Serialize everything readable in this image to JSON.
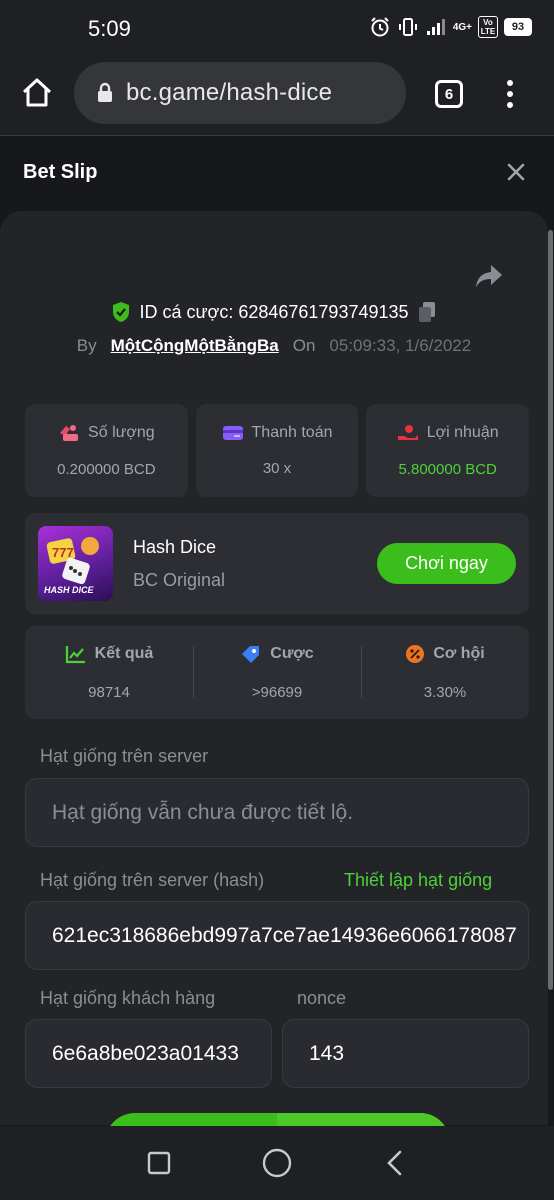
{
  "status_bar": {
    "time": "5:09",
    "network": "4G+",
    "volte": "Vo LTE",
    "battery": "93"
  },
  "browser": {
    "url": "bc.game/hash-dice",
    "tab_count": "6"
  },
  "header": {
    "title": "Bet Slip"
  },
  "bet": {
    "id_text": "ID cá cược: 62846761793749135",
    "by_label": "By",
    "username": "MộtCộngMộtBằngBa",
    "on_label": "On",
    "datetime": "05:09:33, 1/6/2022"
  },
  "stats": [
    {
      "label": "Số lượng",
      "value": "0.200000 BCD"
    },
    {
      "label": "Thanh toán",
      "value": "30 x"
    },
    {
      "label": "Lợi nhuận",
      "value": "5.800000 BCD"
    }
  ],
  "game": {
    "name": "Hash Dice",
    "subtitle": "BC Original",
    "thumb_label": "HASH DICE",
    "play_label": "Chơi ngay"
  },
  "results": [
    {
      "label": "Kết quả",
      "value": "98714"
    },
    {
      "label": "Cược",
      "value": ">96699"
    },
    {
      "label": "Cơ hội",
      "value": "3.30%"
    }
  ],
  "seeds": {
    "server_seed_label": "Hạt giống trên server",
    "server_seed_placeholder": "Hạt giống vẫn chưa được tiết lộ.",
    "server_hash_label": "Hạt giống trên server (hash)",
    "set_seed_link": "Thiết lập hạt giống",
    "server_hash_value": "621ec318686ebd997a7ce7ae14936e6066178087",
    "client_seed_label": "Hạt giống khách hàng",
    "client_seed_value": "6e6a8be023a01433",
    "nonce_label": "nonce",
    "nonce_value": "143"
  },
  "colors": {
    "accent_green": "#3bbd1c",
    "profit_green": "#4cd137",
    "panel_bg": "#232427",
    "card_bg": "#2d2e33"
  }
}
